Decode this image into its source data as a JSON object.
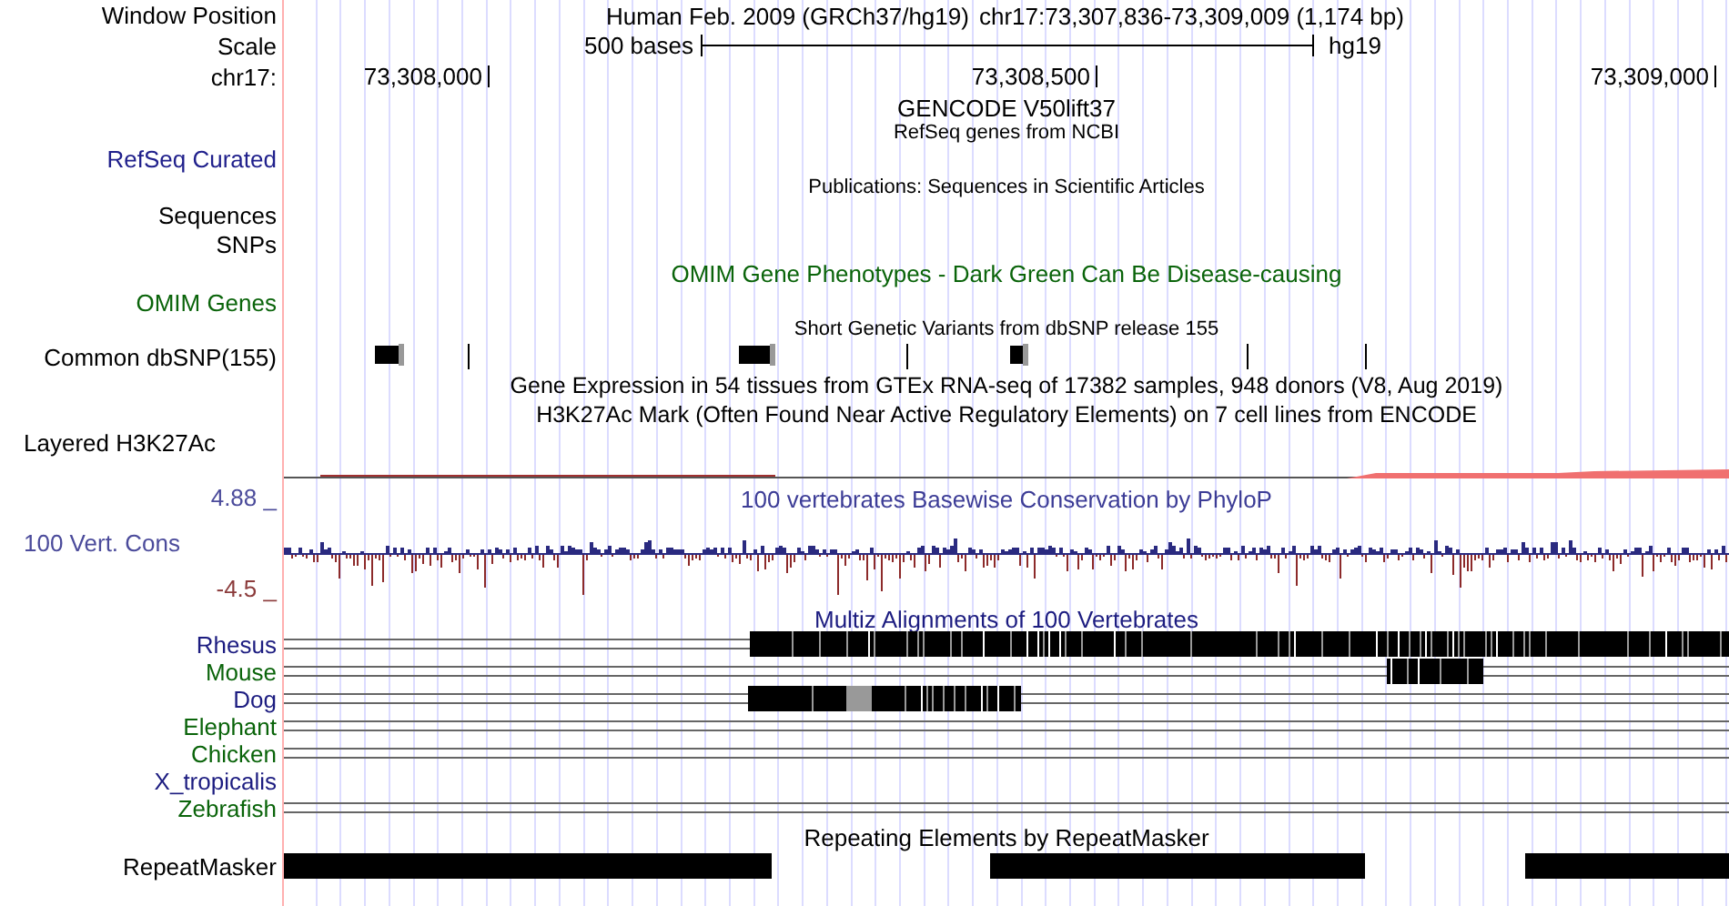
{
  "header": {
    "label": "Window Position",
    "assembly": "Human Feb. 2009 (GRCh37/hg19)",
    "position": "chr17:73,307,836-73,309,009 (1,174 bp)"
  },
  "scale": {
    "label": "Scale",
    "length": "500 bases",
    "assembly": "hg19"
  },
  "ruler": {
    "label": "chr17:",
    "ticks": [
      "73,308,000",
      "73,308,500",
      "73,309,000"
    ]
  },
  "gencode": {
    "title": "GENCODE V50lift37"
  },
  "refseq": {
    "title": "RefSeq genes from NCBI",
    "label": "RefSeq Curated"
  },
  "publications": {
    "title": "Publications: Sequences in Scientific Articles",
    "labels": [
      "Sequences",
      "SNPs"
    ]
  },
  "omim": {
    "title": "OMIM Gene Phenotypes - Dark Green Can Be Disease-causing",
    "label": "OMIM Genes"
  },
  "dbsnp": {
    "title": "Short Genetic Variants from dbSNP release 155",
    "label": "Common dbSNP(155)"
  },
  "gtex": {
    "title": "Gene Expression in 54 tissues from GTEx RNA-seq of 17382 samples, 948 donors (V8, Aug 2019)"
  },
  "h3k27ac": {
    "title": "H3K27Ac Mark (Often Found Near Active Regulatory Elements) on 7 cell lines from ENCODE",
    "label": "Layered H3K27Ac"
  },
  "conservation": {
    "title": "100 vertebrates Basewise Conservation by PhyloP",
    "label": "100 Vert. Cons",
    "max": "4.88 _",
    "min": "-4.5 _"
  },
  "multiz": {
    "title": "Multiz Alignments of 100 Vertebrates",
    "species": [
      {
        "name": "Rhesus",
        "color": "#1c1c80",
        "aligned": true
      },
      {
        "name": "Mouse",
        "color": "#0a640a",
        "aligned": true
      },
      {
        "name": "Dog",
        "color": "#1c1c80",
        "aligned": true
      },
      {
        "name": "Elephant",
        "color": "#0a640a",
        "aligned": true
      },
      {
        "name": "Chicken",
        "color": "#0a640a",
        "aligned": true
      },
      {
        "name": "X_tropicalis",
        "color": "#1c1c80",
        "aligned": false
      },
      {
        "name": "Zebrafish",
        "color": "#0a640a",
        "aligned": true
      }
    ]
  },
  "repeatmasker": {
    "title": "Repeating Elements by RepeatMasker",
    "label": "RepeatMasker"
  }
}
